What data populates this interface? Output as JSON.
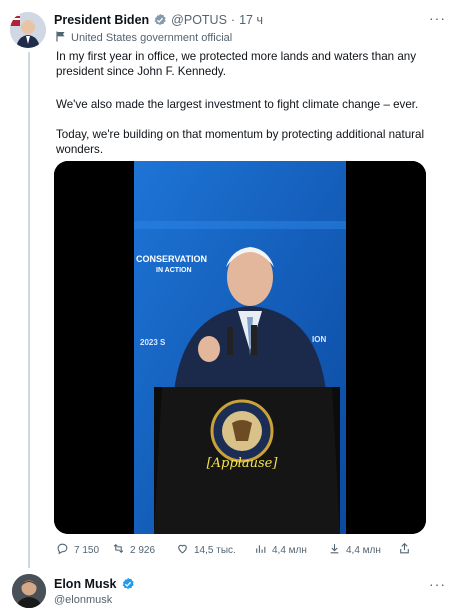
{
  "tweet": {
    "author_name": "President Biden",
    "handle": "@POTUS",
    "separator": "·",
    "time": "17 ч",
    "label": "United States government official",
    "paragraphs": [
      "In my first year in office, we protected more lands and waters than any president since John F. Kennedy.",
      "We've also made the largest investment to fight climate change – ever.",
      "Today, we're building on that momentum by protecting additional natural wonders."
    ],
    "media": {
      "banner_line1": "CONSERVATION",
      "banner_line2": "IN ACTION",
      "year_text": "2023 S",
      "right_text": "ION",
      "caption": "[Applause]"
    },
    "actions": {
      "replies": "7 150",
      "retweets": "2 926",
      "likes": "14,5 тыс.",
      "views": "4,4 млн",
      "bookmarks": "4,4 млн"
    }
  },
  "next_tweet": {
    "author_name": "Elon Musk",
    "handle": "@elonmusk"
  },
  "colors": {
    "verified_blue": "#1d9bf0",
    "muted": "#536471",
    "stage_blue": "#1565c0"
  },
  "icons": [
    "more-icon",
    "verified-icon",
    "government-flag-icon",
    "reply-icon",
    "retweet-icon",
    "like-icon",
    "views-icon",
    "bookmark-icon",
    "share-icon"
  ]
}
